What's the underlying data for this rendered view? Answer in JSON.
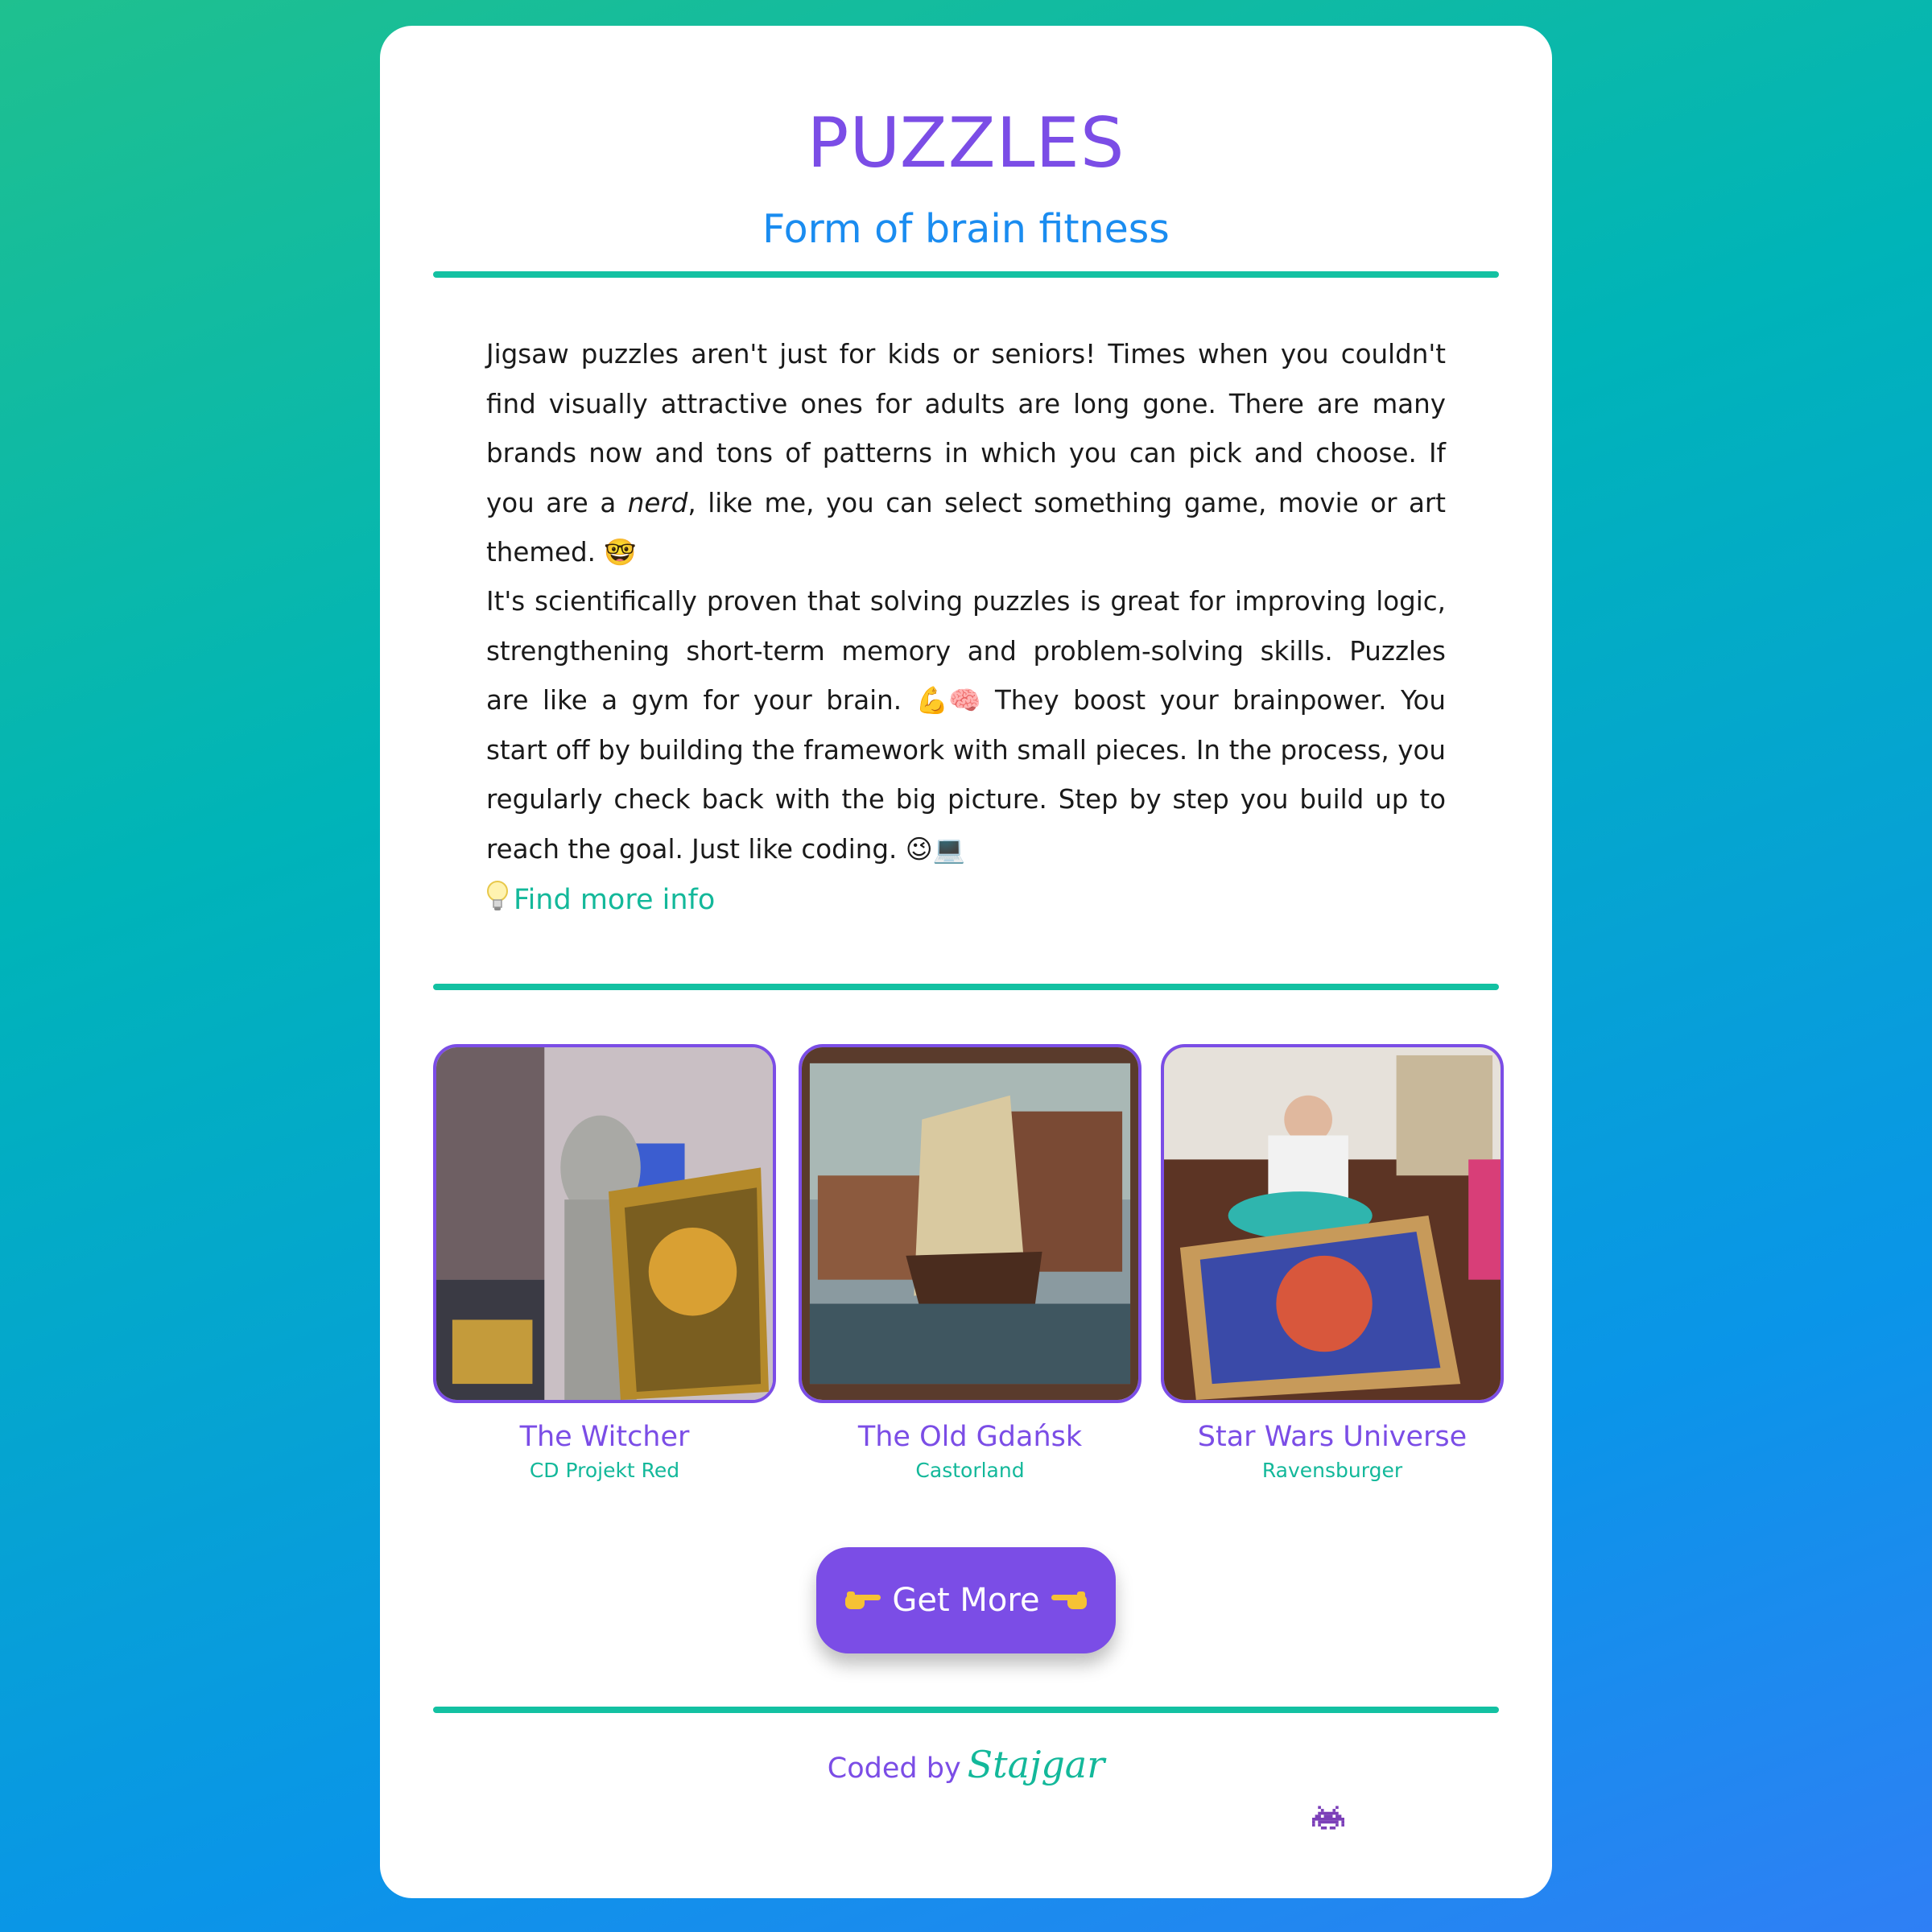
{
  "header": {
    "title": "PUZZLES",
    "subtitle": "Form of brain fitness"
  },
  "intro": {
    "p1_before": "Jigsaw puzzles aren't just for kids or seniors! Times when you couldn't find visually attractive ones for adults are long gone. There are many brands now and tons of patterns in which you can pick and choose. If you are a ",
    "p1_em": "nerd",
    "p1_after": ", like me, you can select something game, movie or art themed. ",
    "p1_emoji": "🤓",
    "p2_before": "It's scientifically proven that solving puzzles is great for improving logic, strengthening short-term memory and problem-solving skills. Puzzles are like a gym for your brain. ",
    "p2_emoji_a": "💪🧠",
    "p2_after": " They boost your brainpower. You start off by building the framework with small pieces. In the process, you regularly check back with the big picture. Step by step you build up to reach the goal. Just like coding. ",
    "p2_emoji_b": "😉💻",
    "link_label": "Find more info",
    "link_icon": "lightbulb-icon"
  },
  "gallery": [
    {
      "name": "The Witcher",
      "brand": "CD Projekt Red"
    },
    {
      "name": "The Old Gdańsk",
      "brand": "Castorland"
    },
    {
      "name": "Star Wars Universe",
      "brand": "Ravensburger"
    }
  ],
  "cta": {
    "label": "Get More",
    "icon_left": "pointing-right-hand-icon",
    "icon_right": "pointing-left-hand-icon"
  },
  "footer": {
    "coded_by": "Coded by",
    "author": "Stajgar",
    "icon": "space-invader-icon"
  },
  "colors": {
    "accent": "#7b4de6",
    "teal": "#13c1a2",
    "subtitle_blue": "#1a8cf0",
    "background_top": "#1fc08f",
    "background_bottom": "#2f7ff5"
  }
}
